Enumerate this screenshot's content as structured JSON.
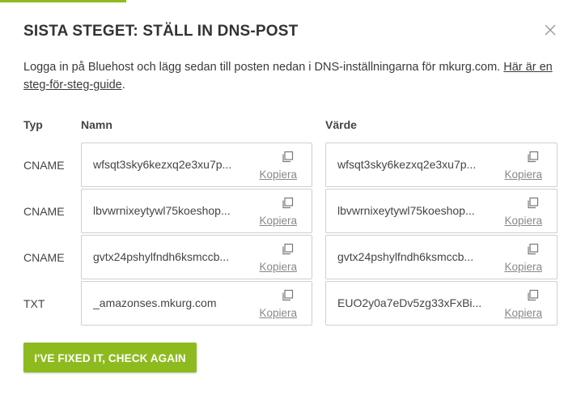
{
  "dialog": {
    "title": "SISTA STEGET: STÄLL IN DNS-POST",
    "intro_text": "Logga in på Bluehost och lägg sedan till posten nedan i DNS-inställningarna för mkurg.com. ",
    "guide_link": "Här är en steg-för-steg-guide",
    "intro_end": ".",
    "close_icon": "close-icon"
  },
  "columns": {
    "type": "Typ",
    "name": "Namn",
    "value": "Värde"
  },
  "records": [
    {
      "type": "CNAME",
      "name": "wfsqt3sky6kezxq2e3xu7p...",
      "value": "wfsqt3sky6kezxq2e3xu7p...",
      "copy": "Kopiera"
    },
    {
      "type": "CNAME",
      "name": "lbvwrnixeytywl75koeshop...",
      "value": "lbvwrnixeytywl75koeshop...",
      "copy": "Kopiera"
    },
    {
      "type": "CNAME",
      "name": "gvtx24pshylfndh6ksmccb...",
      "value": "gvtx24pshylfndh6ksmccb...",
      "copy": "Kopiera"
    },
    {
      "type": "TXT",
      "name": "_amazonses.mkurg.com",
      "value": "EUO2y0a7eDv5zg33xFxBi...",
      "copy": "Kopiera"
    }
  ],
  "actions": {
    "check_again": "I'VE FIXED IT, CHECK AGAIN"
  },
  "colors": {
    "accent": "#8dbb1f"
  }
}
